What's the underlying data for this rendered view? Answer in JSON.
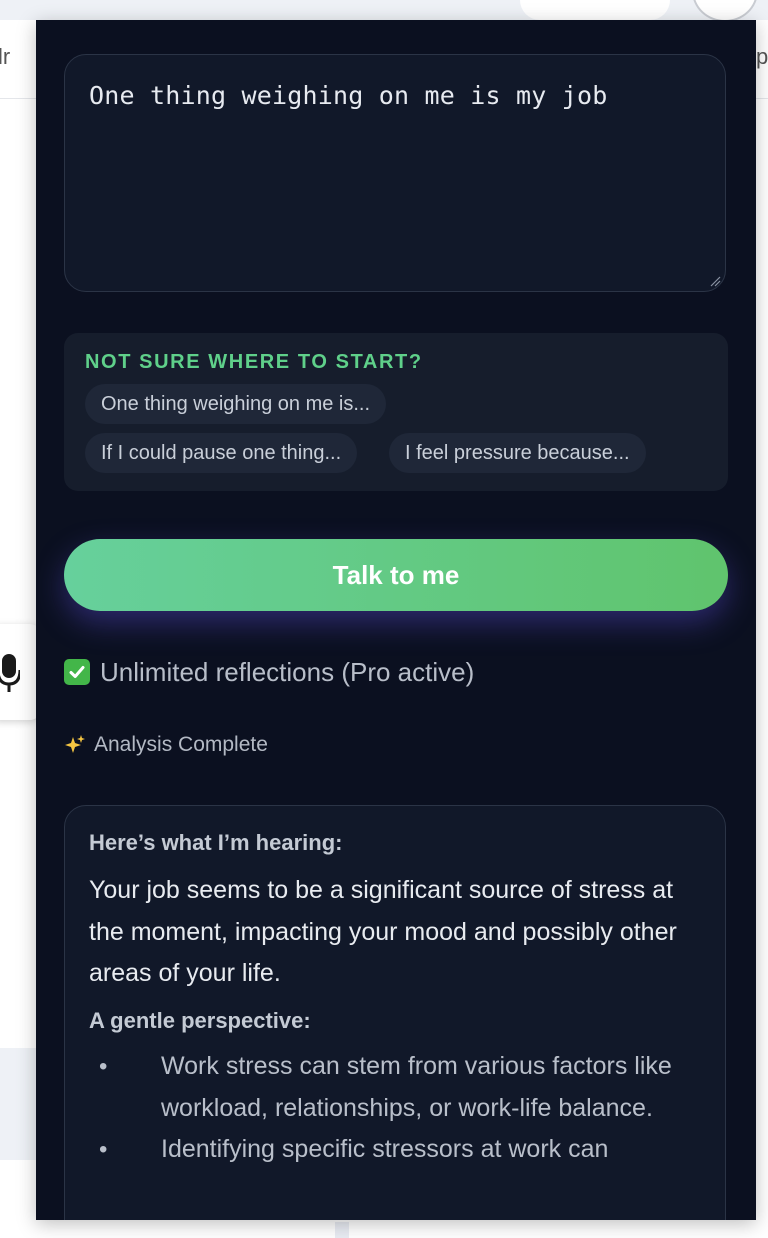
{
  "background": {
    "left_fragment": "lr",
    "right_fragment": "p"
  },
  "input": {
    "value": "One thing weighing on me is my job"
  },
  "suggestions": {
    "title": "NOT SURE WHERE TO START?",
    "chips": [
      "One thing weighing on me is...",
      "If I could pause one thing...",
      "I feel pressure because..."
    ]
  },
  "talk_button": {
    "label": "Talk to me"
  },
  "pro_status": {
    "text": "Unlimited reflections (Pro active)",
    "icon": "check-icon"
  },
  "analysis": {
    "status": "Analysis Complete",
    "icon": "sparkle-icon"
  },
  "result": {
    "hearing_heading": "Here’s what I’m hearing:",
    "hearing_text": "Your job seems to be a significant source of stress at the moment, impacting your mood and possibly other areas of your life.",
    "perspective_heading": "A gentle perspective:",
    "bullets": [
      "Work stress can stem from various factors like workload, relationships, or work-life balance.",
      "Identifying specific stressors at work can"
    ]
  },
  "colors": {
    "panel_bg": "#0b1020",
    "accent_green": "#5fd08a",
    "button_gradient_start": "#66d09c",
    "button_gradient_end": "#60c46d"
  }
}
